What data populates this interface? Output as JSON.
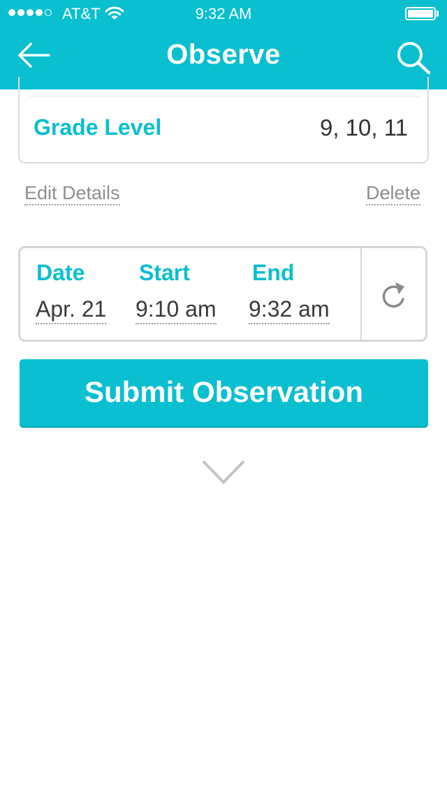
{
  "status_bar": {
    "carrier": "AT&T",
    "time": "9:32 AM",
    "signal_bars_filled": 4,
    "signal_bars_total": 5,
    "wifi_icon": "wifi-icon",
    "battery_icon": "battery-icon"
  },
  "header": {
    "title": "Observe",
    "back_icon": "arrow-left-icon",
    "search_icon": "search-icon"
  },
  "details_card": {
    "grade_label": "Grade Level",
    "grade_value": "9, 10, 11"
  },
  "actions": {
    "edit_label": "Edit Details",
    "delete_label": "Delete"
  },
  "time_card": {
    "date_label": "Date",
    "date_value": "Apr. 21",
    "start_label": "Start",
    "start_value": "9:10 am",
    "end_label": "End",
    "end_value": "9:32 am",
    "refresh_icon": "refresh-icon"
  },
  "submit_label": "Submit Observation",
  "expand_icon": "chevron-down-icon",
  "colors": {
    "accent": "#09bfd0",
    "text_dark": "#333333",
    "text_muted": "#8e8e8e",
    "border": "#d6d6d6"
  }
}
